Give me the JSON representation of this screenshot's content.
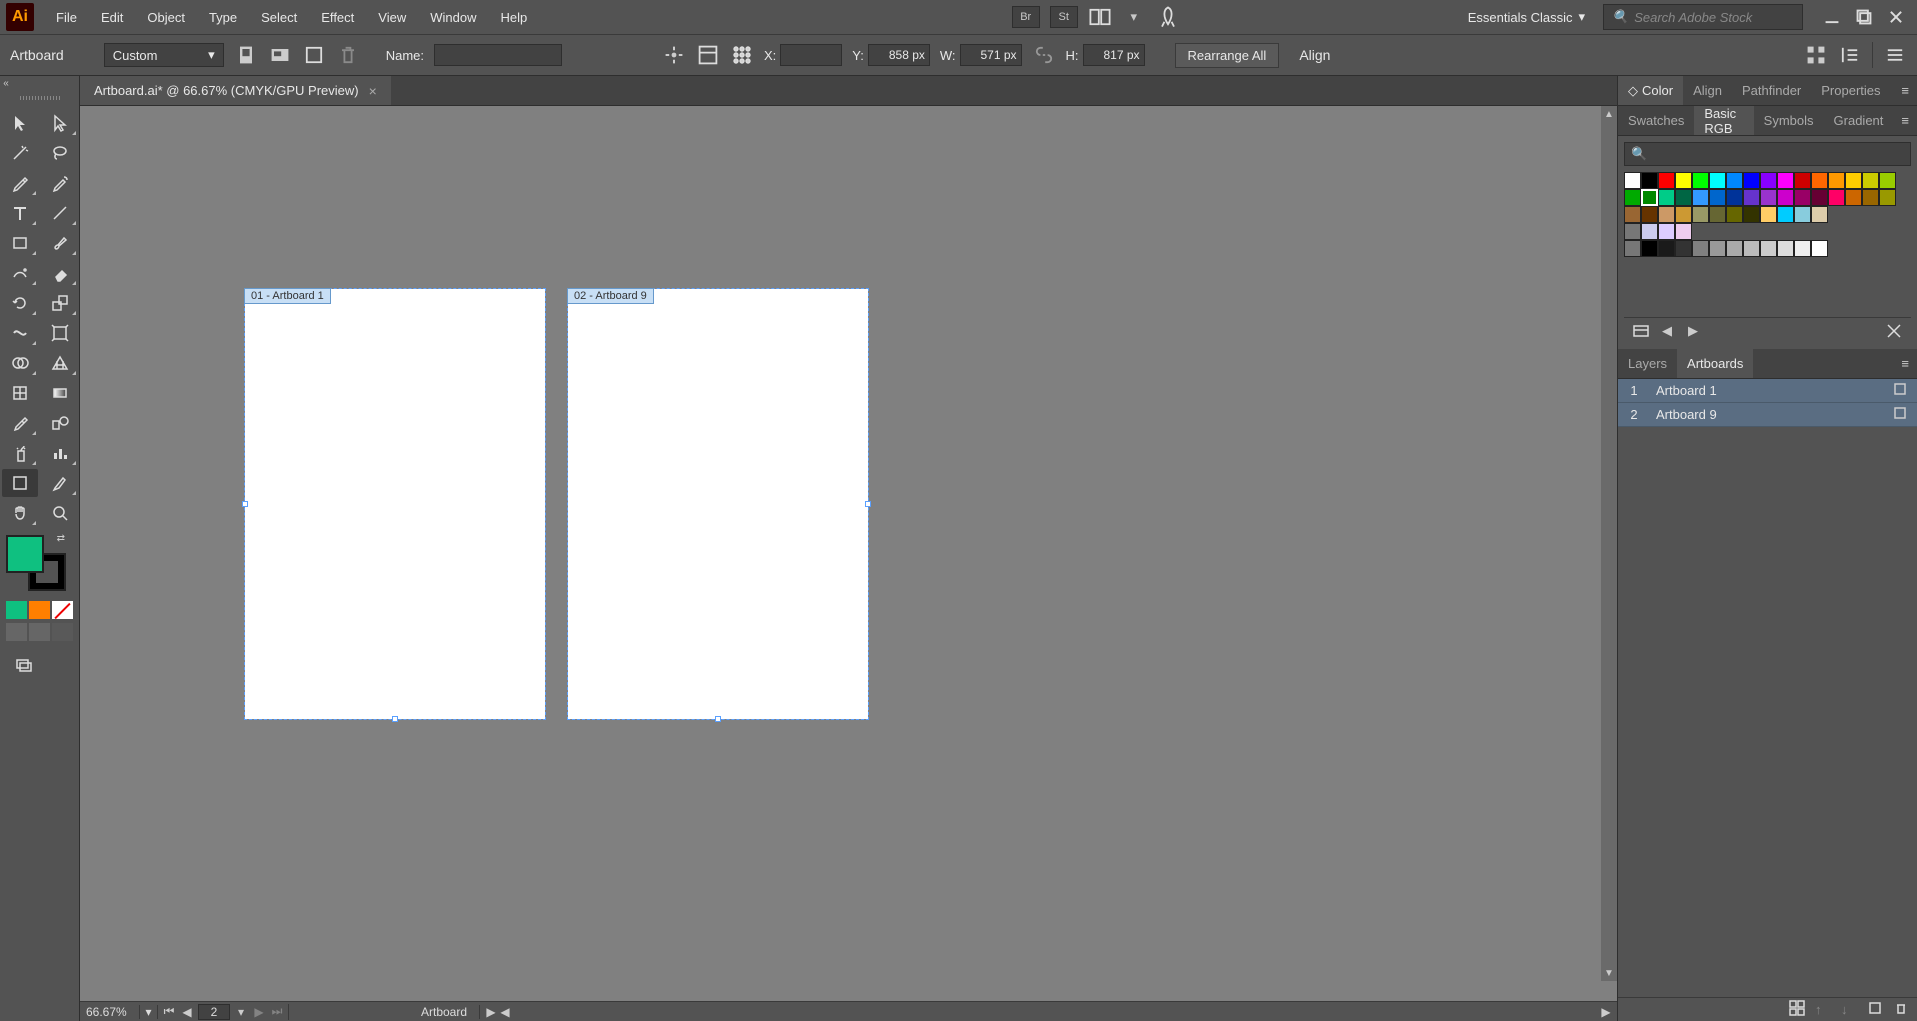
{
  "app_logo": "Ai",
  "menu": {
    "items": [
      "File",
      "Edit",
      "Object",
      "Type",
      "Select",
      "Effect",
      "View",
      "Window",
      "Help"
    ]
  },
  "topbar": {
    "br_label": "Br",
    "st_label": "St",
    "workspace": "Essentials Classic",
    "search_placeholder": "Search Adobe Stock"
  },
  "controlbar": {
    "tool_label": "Artboard",
    "preset": "Custom",
    "name_label": "Name:",
    "name_value": "",
    "x_label": "X:",
    "x_value": "",
    "y_label": "Y:",
    "y_value": "858 px",
    "w_label": "W:",
    "w_value": "571 px",
    "h_label": "H:",
    "h_value": "817 px",
    "rearrange": "Rearrange All",
    "align": "Align"
  },
  "document": {
    "tab_title": "Artboard.ai* @ 66.67% (CMYK/GPU Preview)",
    "artboards": [
      {
        "label": "01 - Artboard 1"
      },
      {
        "label": "02 - Artboard 9"
      }
    ]
  },
  "statusbar": {
    "zoom": "66.67%",
    "artboard_index": "2",
    "tool": "Artboard"
  },
  "panels": {
    "top_tabs": [
      "Color",
      "Align",
      "Pathfinder",
      "Properties"
    ],
    "swatch_tabs": [
      "Swatches",
      "Basic RGB",
      "Symbols",
      "Gradient"
    ],
    "colors_row1": [
      "#ffffff",
      "#000000",
      "#ff0000",
      "#ffff00",
      "#00ff00",
      "#00ffff",
      "#0088ff",
      "#0000ff",
      "#8800ff",
      "#ff00ff",
      "#cc0000",
      "#ff6600",
      "#ff9900",
      "#ffcc00",
      "#cccc00",
      "#99cc00"
    ],
    "colors_row2": [
      "#00aa00",
      "#008800",
      "#00cc88",
      "#006644",
      "#3399ff",
      "#0066cc",
      "#003399",
      "#6633cc",
      "#9933cc",
      "#cc00cc",
      "#990066",
      "#660033",
      "#ff0066",
      "#cc6600",
      "#996600",
      "#999900"
    ],
    "colors_row3": [
      "#996633",
      "#663300",
      "#cc9966",
      "#cc9933",
      "#999966",
      "#666633",
      "#666600",
      "#333300",
      "#ffcc66",
      "#00ccff",
      "#88ccdd",
      "#ddccaa"
    ],
    "colors_pastel": [
      "#ccccee",
      "#ddccff",
      "#eeccee"
    ],
    "colors_gray": [
      "#000000",
      "#1a1a1a",
      "#333333",
      "#808080",
      "#999999",
      "#aaaaaa",
      "#bbbbbb",
      "#cccccc",
      "#dddddd",
      "#eeeeee",
      "#ffffff"
    ],
    "bottom_tabs": [
      "Layers",
      "Artboards"
    ],
    "artboard_rows": [
      {
        "num": "1",
        "name": "Artboard 1"
      },
      {
        "num": "2",
        "name": "Artboard 9"
      }
    ]
  },
  "fill_color": "#0fc080"
}
